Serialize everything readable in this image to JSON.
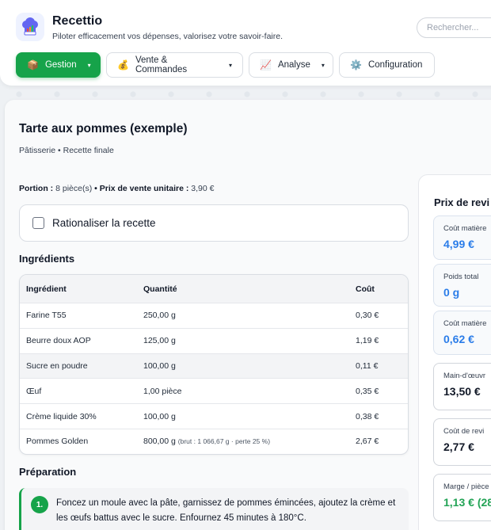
{
  "app": {
    "title": "Recettio",
    "subtitle": "Piloter efficacement vos dépenses, valorisez votre savoir-faire."
  },
  "search": {
    "placeholder": "Rechercher..."
  },
  "nav": [
    {
      "label": "Gestion",
      "icon": "📦",
      "active": true
    },
    {
      "label": "Vente & Commandes",
      "icon": "💰",
      "active": false
    },
    {
      "label": "Analyse",
      "icon": "📈",
      "active": false
    },
    {
      "label": "Configuration",
      "icon": "⚙️",
      "active": false
    }
  ],
  "caret": "▾",
  "recipe": {
    "title": "Tarte aux pommes (exemple)",
    "category": "Pâtisserie • Recette finale",
    "portion_label": "Portion :",
    "portion_value": "8 pièce(s)",
    "separator": "•",
    "price_label": "Prix de vente unitaire :",
    "price_value": "3,90 €"
  },
  "rationalize": {
    "label": "Rationaliser la recette",
    "checked": false
  },
  "ingredients": {
    "title": "Ingrédients",
    "headers": [
      "Ingrédient",
      "Quantité",
      "Coût"
    ],
    "rows": [
      {
        "name": "Farine T55",
        "qty": "250,00 g",
        "note": "",
        "cost": "0,30 €"
      },
      {
        "name": "Beurre doux AOP",
        "qty": "125,00 g",
        "note": "",
        "cost": "1,19 €"
      },
      {
        "name": "Sucre en poudre",
        "qty": "100,00 g",
        "note": "",
        "cost": "0,11 €"
      },
      {
        "name": "Œuf",
        "qty": "1,00 pièce",
        "note": "",
        "cost": "0,35 €"
      },
      {
        "name": "Crème liquide 30%",
        "qty": "100,00 g",
        "note": "",
        "cost": "0,38 €"
      },
      {
        "name": "Pommes Golden",
        "qty": "800,00 g",
        "note": "(brut : 1 066,67 g · perte 25 %)",
        "cost": "2,67 €"
      }
    ]
  },
  "preparation": {
    "title": "Préparation",
    "steps": [
      {
        "num": "1.",
        "text": "Foncez un moule avec la pâte, garnissez de pommes émincées, ajoutez la crème et les œufs battus avec le sucre. Enfournez 45 minutes à 180°C."
      }
    ]
  },
  "cost_panel": {
    "title": "Prix de revi",
    "kpis": [
      {
        "label": "Coût matière",
        "value": "4,99 €",
        "color": "#2b7de9"
      },
      {
        "label": "Poids total",
        "value": "0 g",
        "color": "#2b7de9"
      },
      {
        "label": "Coût matière",
        "value": "0,62 €",
        "color": "#2b7de9"
      },
      {
        "label": "Main-d'œuvr",
        "value": "13,50 €",
        "color": "#111827"
      },
      {
        "label": "Coût de revi",
        "value": "2,77 €",
        "color": "#111827"
      },
      {
        "label": "Marge / pièce",
        "value": "1,13 € (28",
        "color": "#22a355"
      }
    ]
  },
  "colors": {
    "accent": "#16a34a",
    "blue": "#2b7de9",
    "green": "#22a355"
  }
}
